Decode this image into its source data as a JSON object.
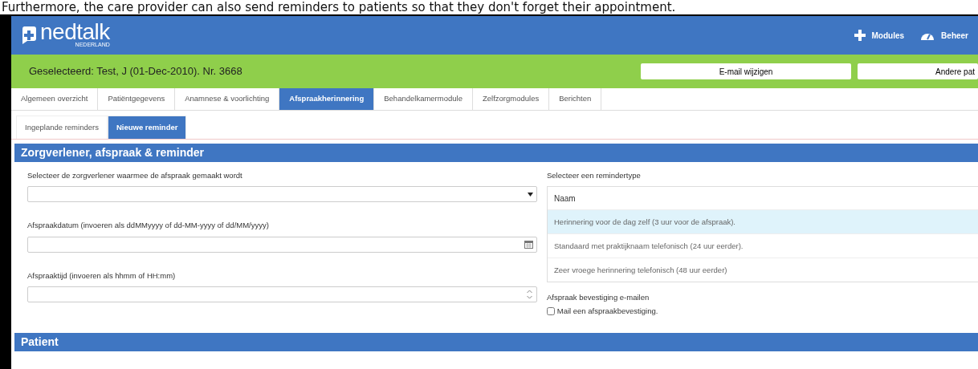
{
  "caption": "Furthermore, the care provider can also send reminders to patients so that they don't forget their appointment.",
  "header": {
    "logo_text": "nedtalk",
    "logo_sub": "NEDERLAND",
    "nav": [
      {
        "label": "Modules"
      },
      {
        "label": "Beheer"
      }
    ]
  },
  "patient_bar": {
    "selected_text": "Geselecteerd: Test, J (01-Dec-2010). Nr. 3668",
    "buttons": [
      "E-mail wijzigen",
      "Andere pat"
    ]
  },
  "tabs": [
    {
      "label": "Algemeen overzicht",
      "selected": false
    },
    {
      "label": "Patiëntgegevens",
      "selected": false
    },
    {
      "label": "Anamnese & voorlichting",
      "selected": false
    },
    {
      "label": "Afspraakherinnering",
      "selected": true
    },
    {
      "label": "Behandelkamermodule",
      "selected": false
    },
    {
      "label": "Zelfzorgmodules",
      "selected": false
    },
    {
      "label": "Berichten",
      "selected": false
    }
  ],
  "subtabs": [
    {
      "label": "Ingeplande reminders",
      "selected": false
    },
    {
      "label": "Nieuwe reminder",
      "selected": true
    }
  ],
  "section": {
    "title": "Zorgverlener, afspraak & reminder",
    "fields": [
      {
        "label": "Selecteer de zorgverlener waarmee de afspraak gemaakt wordt",
        "kind": "select"
      },
      {
        "label": "Afspraakdatum (invoeren als ddMMyyyy of dd-MM-yyyy of dd/MM/yyyy)",
        "kind": "date"
      },
      {
        "label": "Afspraaktijd (invoeren als hhmm of HH:mm)",
        "kind": "time"
      }
    ],
    "reminder_type": {
      "label": "Selecteer een remindertype",
      "column": "Naam",
      "options": [
        {
          "label": "Herinnering voor de dag zelf (3 uur voor de afspraak).",
          "selected": true
        },
        {
          "label": "Standaard met praktijknaam telefonisch (24 uur eerder).",
          "selected": false
        },
        {
          "label": "Zeer vroege herinnering telefonisch (48 uur eerder)",
          "selected": false
        }
      ]
    },
    "confirmation": {
      "label": "Afspraak bevestiging e-mailen",
      "checkbox_label": "Mail een afspraakbevestiging.",
      "checked": false
    }
  },
  "section2": {
    "title": "Patient"
  }
}
